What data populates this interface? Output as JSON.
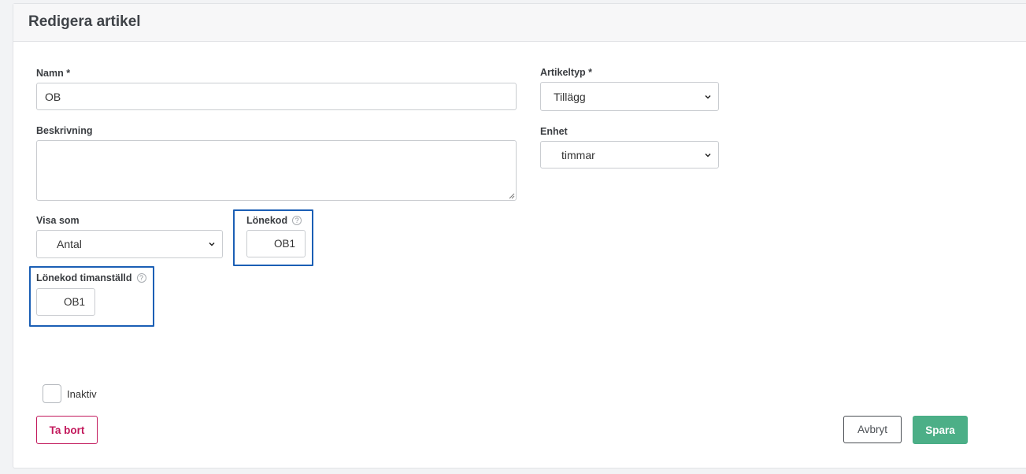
{
  "header": {
    "title": "Redigera artikel"
  },
  "form": {
    "name": {
      "label": "Namn *",
      "value": "OB"
    },
    "description": {
      "label": "Beskrivning",
      "value": ""
    },
    "display_as": {
      "label": "Visa som",
      "value": "Antal"
    },
    "wage_code": {
      "label": "Lönekod",
      "help": "?",
      "value": "OB1"
    },
    "wage_code_hourly": {
      "label": "Lönekod timanställd",
      "help": "?",
      "value": "OB1"
    },
    "article_type": {
      "label": "Artikeltyp *",
      "value": "Tillägg"
    },
    "unit": {
      "label": "Enhet",
      "value": "timmar"
    },
    "inactive": {
      "label": "Inaktiv",
      "checked": false
    }
  },
  "buttons": {
    "delete": "Ta bort",
    "cancel": "Avbryt",
    "save": "Spara"
  },
  "colors": {
    "highlight": "#1b5fb5",
    "danger": "#c2185b",
    "primary": "#4caf87"
  }
}
